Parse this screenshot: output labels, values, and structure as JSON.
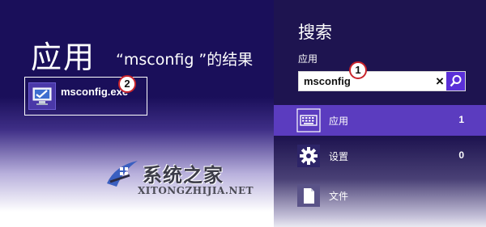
{
  "apps_panel": {
    "title": "应用",
    "results_heading": "“msconfig ”的结果",
    "result": {
      "label": "msconfig.exe",
      "badge": "2"
    }
  },
  "search_panel": {
    "title": "搜索",
    "scope_label": "应用",
    "query": "msconfig",
    "badge": "1",
    "clear_icon": "×",
    "categories": [
      {
        "label": "应用",
        "count": "1",
        "icon": "keyboard-icon",
        "selected": true
      },
      {
        "label": "设置",
        "count": "0",
        "icon": "gear-icon",
        "selected": false
      },
      {
        "label": "文件",
        "count": "",
        "icon": "file-icon",
        "selected": false
      }
    ]
  },
  "watermark": {
    "name": "系统之家",
    "url": "XITONGZHIJIA.NET"
  },
  "colors": {
    "left_bg": "#1a0f5a",
    "right_bg": "#1e1450",
    "selected_row": "#5b3cbf",
    "search_button": "#5a2fd8",
    "badge_border": "#c8232b"
  }
}
